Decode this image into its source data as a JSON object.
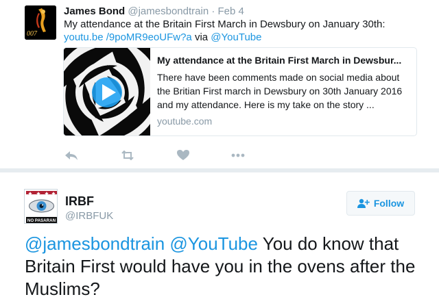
{
  "tweet1": {
    "name": "James Bond",
    "handle": "@jamesbondtrain",
    "separator": "·",
    "date": "Feb 4",
    "avatar_icon": "007-logo-icon",
    "avatar_text": "007",
    "text_before": "My attendance at the Britain First March in Dewsbury on January 30th: ",
    "link1": "youtu.be /9poMR9eoUFw?a",
    "text_mid": " via ",
    "link2": "@YouTube",
    "card": {
      "title": "My attendance at the Britain First March in Dewsbur...",
      "description": "There have been comments made on social media about the Britian First march in Dewsbury on 30th January 2016 and my attendance. Here is my take on the story ...",
      "domain": "youtube.com",
      "thumb_icon": "video-play-icon"
    },
    "actions": [
      "reply-icon",
      "retweet-icon",
      "like-icon",
      "more-icon"
    ]
  },
  "tweet2": {
    "name": "IRBF",
    "handle": "@IRBFUK",
    "avatar_text": "NO PASARAN",
    "follow_label": "Follow",
    "mention1": "@jamesbondtrain",
    "mention2": "@YouTube",
    "text": " You do know that Britain First would have you in the ovens after the Muslims?"
  },
  "colors": {
    "link": "#1b95e0",
    "muted": "#8899a6",
    "divider": "#e6ecf0"
  }
}
